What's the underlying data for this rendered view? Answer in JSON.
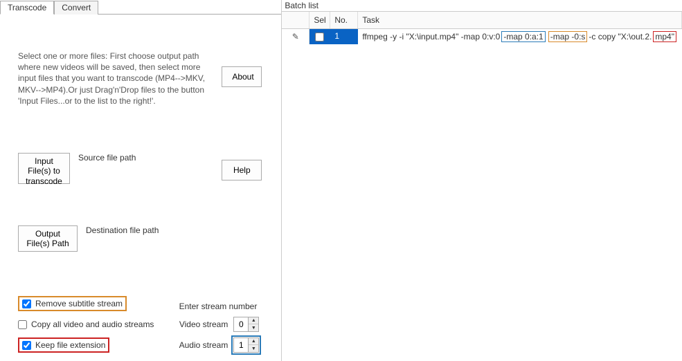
{
  "tabs": {
    "transcode": "Transcode",
    "convert": "Convert"
  },
  "instructions": "Select one or more files: First choose output path where new videos will be saved, then select more input files that you want to transcode (MP4-->MKV, MKV-->MP4).Or just Drag'n'Drop files to the button 'Input Files...or to the list to the right!'.",
  "buttons": {
    "about": "About",
    "help": "Help",
    "inputFiles": "Input File(s) to transcode",
    "outputPath": "Output File(s) Path"
  },
  "labels": {
    "sourcePath": "Source file path",
    "destPath": "Destination file path",
    "removeSubtitle": "Remove subtitle stream",
    "copyAll": "Copy all video and audio streams",
    "keepExt": "Keep file extension",
    "enterStream": "Enter stream number",
    "videoStream": "Video stream",
    "audioStream": "Audio stream"
  },
  "values": {
    "removeSubtitle": true,
    "copyAll": false,
    "keepExt": true,
    "videoStream": "0",
    "audioStream": "1"
  },
  "batch": {
    "title": "Batch list",
    "headers": {
      "sel": "Sel",
      "no": "No.",
      "task": "Task"
    },
    "rows": [
      {
        "no": "1",
        "sel": false,
        "task_parts": {
          "pre": "ffmpeg -y -i \"X:\\input.mp4\"  -map 0:v:0 ",
          "blue": "-map 0:a:1",
          "gap1": " ",
          "orange": "-map -0:s",
          "mid": " -c copy \"X:\\out.2.",
          "red": "mp4\"",
          "post": ""
        }
      }
    ]
  }
}
